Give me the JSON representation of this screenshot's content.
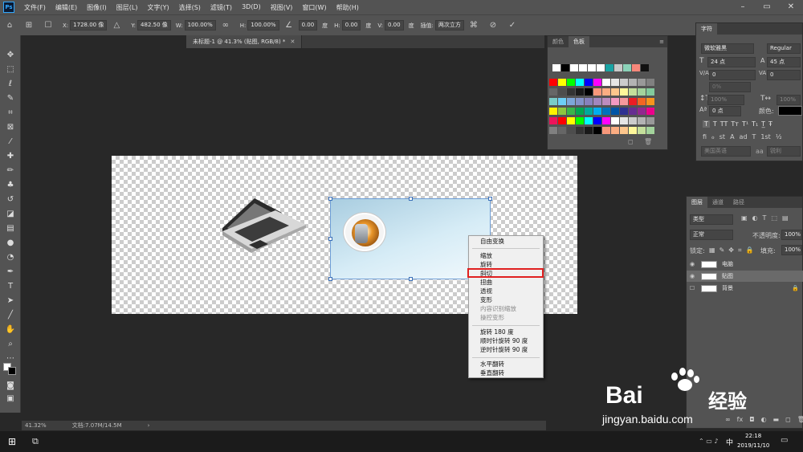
{
  "app": {
    "logo": "Ps"
  },
  "menu": [
    "文件(F)",
    "编辑(E)",
    "图像(I)",
    "图层(L)",
    "文字(Y)",
    "选择(S)",
    "滤镜(T)",
    "3D(D)",
    "视图(V)",
    "窗口(W)",
    "帮助(H)"
  ],
  "options": {
    "x_label": "X:",
    "x": "1728.00 像",
    "y_label": "Y:",
    "y": "482.50 像",
    "w_label": "W:",
    "w": "100.00%",
    "h_label": "H:",
    "h": "100.00%",
    "angle": "0.00",
    "angle_unit": "度",
    "hskew_label": "H:",
    "hskew": "0.00",
    "hskew_unit": "度",
    "vskew_label": "V:",
    "vskew": "0.00",
    "vskew_unit": "度",
    "interp_label": "插值:",
    "interp": "两次立方"
  },
  "document": {
    "tab_title": "未标题-1 @ 41.3% (贴图, RGB/8) *",
    "zoom": "41.32%",
    "doc_size": "文档:7.07M/14.5M"
  },
  "context_menu": {
    "items": [
      "自由变换",
      "缩放",
      "旋转",
      "斜切",
      "扭曲",
      "透视",
      "变形",
      "内容识别缩放",
      "操控变形",
      "旋转 180 度",
      "顺时针旋转 90 度",
      "逆时针旋转 90 度",
      "水平翻转",
      "垂直翻转"
    ],
    "highlighted": "斜切",
    "disabled": [
      "内容识别缩放",
      "操控变形"
    ]
  },
  "swatch_panel": {
    "tabs": [
      "颜色",
      "色板"
    ],
    "active_tab": "色板"
  },
  "character_panel": {
    "title": "字符",
    "font": "微软雅黑",
    "style": "Regular",
    "size": "24 点",
    "leading": "45 点",
    "kerning": "0",
    "tracking": "0",
    "vscale": "100%",
    "hscale": "100%",
    "baseline": "0 点",
    "color_label": "颜色:",
    "language": "美国英语",
    "aa_label": "aa",
    "aa_value": "锐利"
  },
  "layers_panel": {
    "tabs": [
      "图层",
      "通道",
      "路径"
    ],
    "filter_kind": "类型",
    "blend_mode": "正常",
    "opacity_label": "不透明度:",
    "opacity": "100%",
    "lock_label": "锁定:",
    "fill_label": "填充:",
    "fill": "100%",
    "layers": [
      {
        "name": "电脑",
        "visible": true,
        "selected": false
      },
      {
        "name": "贴图",
        "visible": true,
        "selected": true
      },
      {
        "name": "背景",
        "visible": false,
        "selected": false,
        "locked": true
      }
    ]
  },
  "taskbar": {
    "time": "22:18",
    "date": "2019/11/10",
    "ime": "中"
  },
  "watermark": {
    "brand": "Bai",
    "brand_suffix": "经验",
    "url": "jingyan.baidu.com"
  },
  "colors": {
    "highlight": "#e02020",
    "accent": "#31a8ff",
    "selection": "#6f9ed6"
  }
}
